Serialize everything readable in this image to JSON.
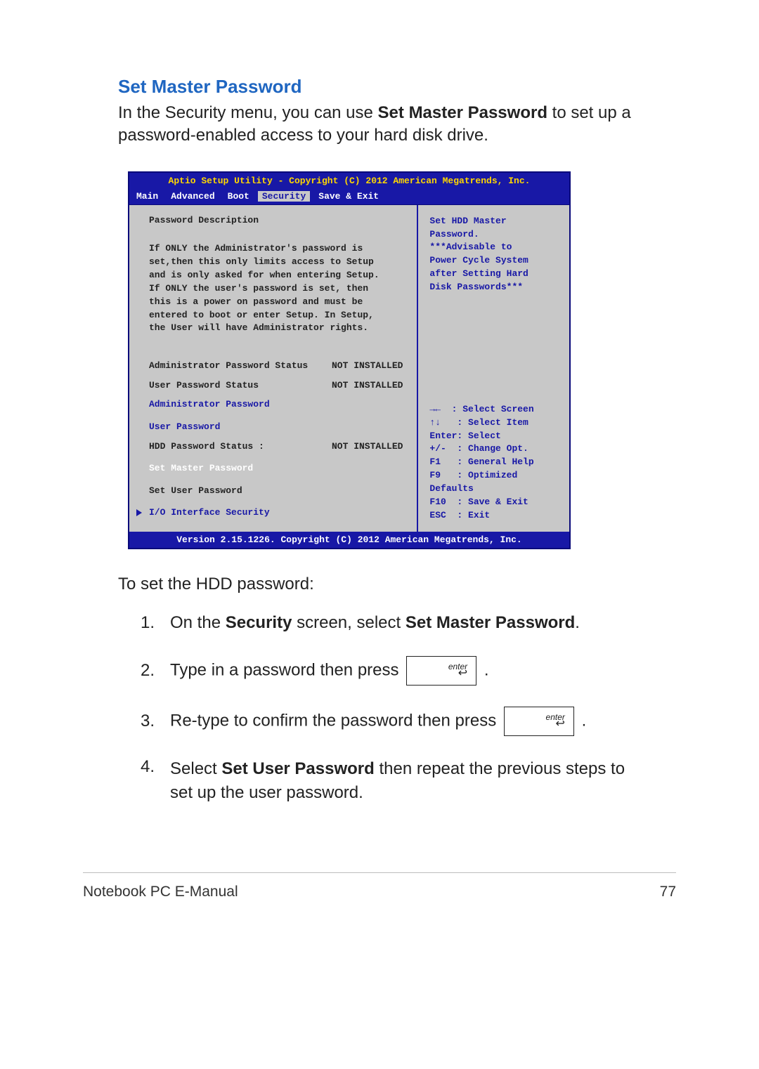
{
  "section_title": "Set Master Password",
  "intro_text_1": "In the Security menu, you can use ",
  "intro_bold": "Set Master Password",
  "intro_text_2": " to set up a password-enabled access to your hard disk drive.",
  "bios": {
    "header": "Aptio Setup Utility - Copyright (C) 2012 American Megatrends, Inc.",
    "tabs": [
      "Main",
      "Advanced",
      "Boot",
      "Security",
      "Save & Exit"
    ],
    "active_tab": "Security",
    "left": {
      "heading": "Password Description",
      "desc_lines": [
        "If ONLY the Administrator's password is",
        "set,then this only limits access to Setup",
        "and is only asked for when entering Setup.",
        "If ONLY the user's password is set, then",
        "this is a power on password and must be",
        "entered to boot or enter Setup. In Setup,",
        "the User will have Administrator rights."
      ],
      "rows": [
        {
          "label": "Administrator Password Status",
          "value": "NOT INSTALLED",
          "cls": "blk"
        },
        {
          "label": "User Password Status",
          "value": "NOT INSTALLED",
          "cls": "blk"
        },
        {
          "label": "Administrator Password",
          "value": "",
          "cls": "blue"
        },
        {
          "label": "User Password",
          "value": "",
          "cls": "blue"
        },
        {
          "label": "HDD Password Status :",
          "value": "NOT INSTALLED",
          "cls": "blk"
        },
        {
          "label": "Set Master Password",
          "value": "",
          "cls": "white"
        },
        {
          "label": "Set User Password",
          "value": "",
          "cls": "blk"
        }
      ],
      "submenu": "I/O Interface Security"
    },
    "right_top": [
      "Set HDD Master",
      "Password.",
      "***Advisable to",
      "Power Cycle System",
      "after Setting Hard",
      "Disk Passwords***"
    ],
    "right_bottom": [
      "→←  : Select Screen",
      "↑↓   : Select Item",
      "Enter: Select",
      "+/-  : Change Opt.",
      "F1   : General Help",
      "F9   : Optimized",
      "Defaults",
      "F10  : Save & Exit",
      "ESC  : Exit"
    ],
    "footer": "Version 2.15.1226. Copyright (C) 2012 American Megatrends, Inc."
  },
  "subheading": "To set the HDD password:",
  "steps": {
    "s1_num": "1.",
    "s1_t1": "On the ",
    "s1_b1": "Security",
    "s1_t2": " screen, select ",
    "s1_b2": "Set Master Password",
    "s1_t3": ".",
    "s2_num": "2.",
    "s2_text": "Type in a password then press ",
    "s2_after": ".",
    "s3_num": "3.",
    "s3_text": "Re-type to confirm the password then press ",
    "s3_after": ".",
    "s4_num": "4.",
    "s4_t1": "Select ",
    "s4_b1": "Set User Password",
    "s4_t2": " then repeat the previous steps to set up the user password."
  },
  "enter_label": "enter",
  "enter_arrow": "↩",
  "footer_left": "Notebook PC E-Manual",
  "footer_right": "77"
}
